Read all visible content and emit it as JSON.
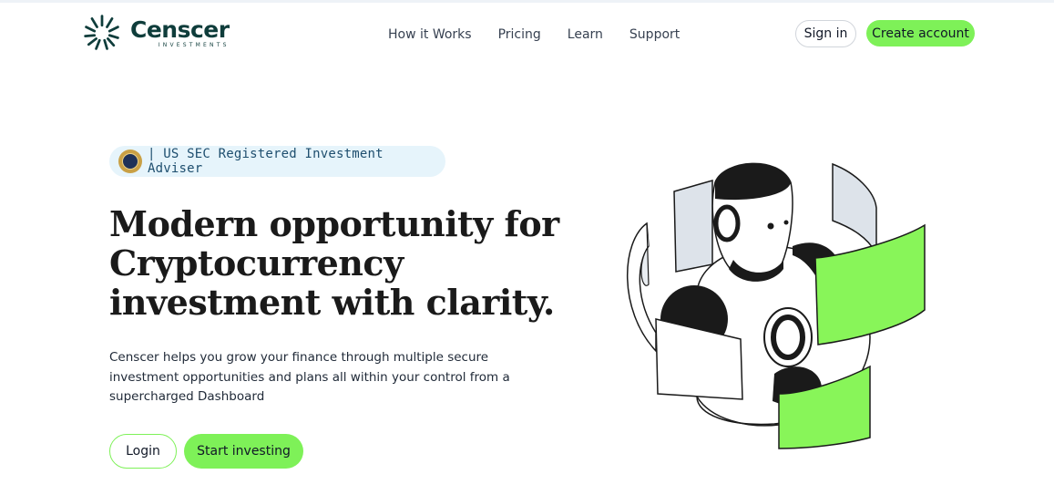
{
  "brand": {
    "name": "Censcer",
    "sub": "INVESTMENTS",
    "accent": "#7ef158",
    "dark": "#0f3d3b"
  },
  "nav": {
    "items": [
      "How it Works",
      "Pricing",
      "Learn",
      "Support"
    ]
  },
  "header": {
    "signin_label": "Sign in",
    "create_label": "Create account"
  },
  "badge": {
    "text": "| US SEC Registered Investment Adviser"
  },
  "hero": {
    "headline": "Modern opportunity for Cryptocurrency investment with clarity.",
    "description": "Censcer helps you grow your finance through multiple secure investment opportunities and plans all within your control from a supercharged Dashboard",
    "login_label": "Login",
    "start_label": "Start investing"
  },
  "icons": {
    "logo": "sunburst-logo-icon",
    "seal": "sec-seal-icon",
    "illustration": "robot-illustration"
  }
}
